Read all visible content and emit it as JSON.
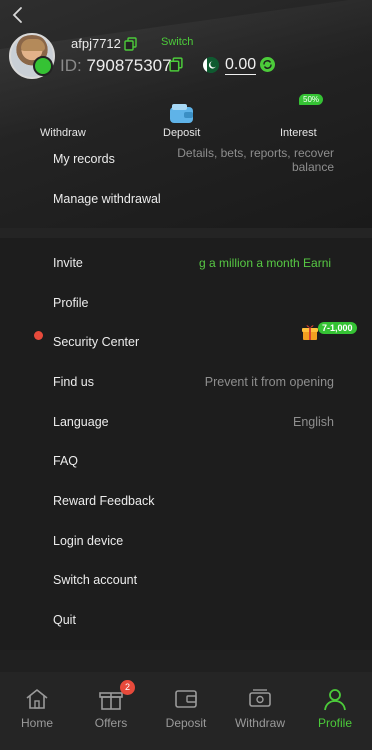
{
  "header": {
    "username": "afpj7712",
    "switch_label": "Switch",
    "id_label": "ID:",
    "id_value": "790875307",
    "balance": "0.00"
  },
  "actions": [
    {
      "label": "Withdraw",
      "icon": "withdraw-icon"
    },
    {
      "label": "Deposit",
      "icon": "wallet-icon"
    },
    {
      "label": "Interest",
      "icon": "interest-icon",
      "badge": "50%"
    }
  ],
  "menu": {
    "records": {
      "label": "My records",
      "value": "Details, bets, reports, recover balance"
    },
    "manage_withdrawal": {
      "label": "Manage withdrawal"
    },
    "invite": {
      "label": "Invite",
      "value": "g a million a month  Earni"
    },
    "profile": {
      "label": "Profile"
    },
    "security": {
      "label": "Security Center",
      "badge": "7-1,000"
    },
    "find_us": {
      "label": "Find us",
      "value": "Prevent it from opening"
    },
    "language": {
      "label": "Language",
      "value": "English"
    },
    "faq": {
      "label": "FAQ"
    },
    "reward_feedback": {
      "label": "Reward Feedback"
    },
    "login_device": {
      "label": "Login device"
    },
    "switch_account": {
      "label": "Switch account"
    },
    "quit": {
      "label": "Quit"
    }
  },
  "tabs": [
    {
      "label": "Home",
      "icon": "home-icon"
    },
    {
      "label": "Offers",
      "icon": "gift-icon",
      "badge": "2"
    },
    {
      "label": "Deposit",
      "icon": "deposit-wallet-icon"
    },
    {
      "label": "Withdraw",
      "icon": "withdraw-icon"
    },
    {
      "label": "Profile",
      "icon": "profile-icon",
      "active": true
    }
  ],
  "colors": {
    "accent": "#4ccb3a",
    "badge_red": "#e74a3b",
    "background": "#1d1d1d",
    "tabbar": "#252525"
  }
}
